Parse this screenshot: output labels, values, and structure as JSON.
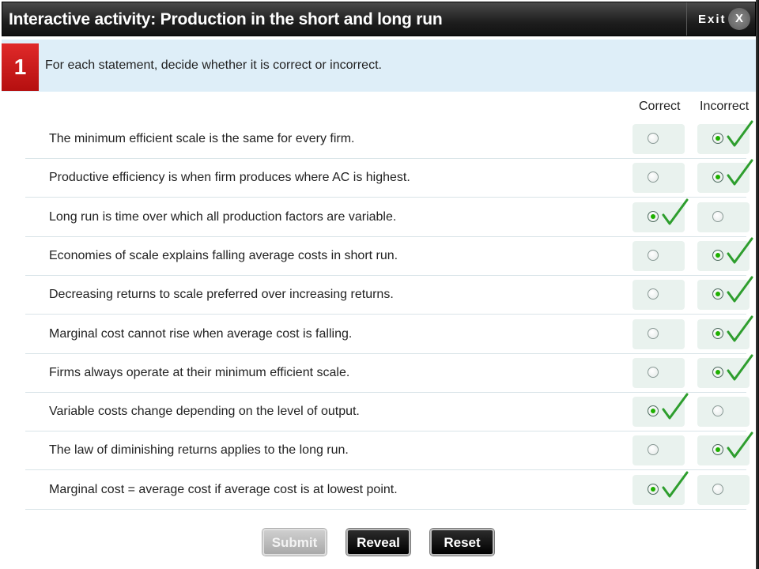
{
  "header": {
    "title": "Interactive activity: Production in the short and long run",
    "exit_label": "Exit",
    "close_label": "X"
  },
  "question": {
    "number": "1",
    "text": "For each statement, decide whether it is correct or incorrect."
  },
  "columns": {
    "correct": "Correct",
    "incorrect": "Incorrect"
  },
  "statements": [
    {
      "text": "The minimum efficient scale is the same for every firm.",
      "selected": "incorrect"
    },
    {
      "text": "Productive efficiency is when firm produces where AC is highest.",
      "selected": "incorrect"
    },
    {
      "text": "Long run is time over which all production factors are variable.",
      "selected": "correct"
    },
    {
      "text": "Economies of scale explains falling average costs in short run.",
      "selected": "incorrect"
    },
    {
      "text": "Decreasing returns to scale preferred over increasing returns.",
      "selected": "incorrect"
    },
    {
      "text": "Marginal cost cannot rise when average cost is falling.",
      "selected": "incorrect"
    },
    {
      "text": "Firms always operate at their minimum efficient scale.",
      "selected": "incorrect"
    },
    {
      "text": "Variable costs change depending on the level of output.",
      "selected": "correct"
    },
    {
      "text": "The law of diminishing returns applies to the long run.",
      "selected": "incorrect"
    },
    {
      "text": "Marginal cost = average cost if average cost is at lowest point.",
      "selected": "correct"
    }
  ],
  "buttons": {
    "submit": "Submit",
    "reveal": "Reveal",
    "reset": "Reset"
  },
  "colors": {
    "check": "#2e9e2e",
    "radio_selected": "#1eb000",
    "question_number_bg": "#d11a1a"
  }
}
